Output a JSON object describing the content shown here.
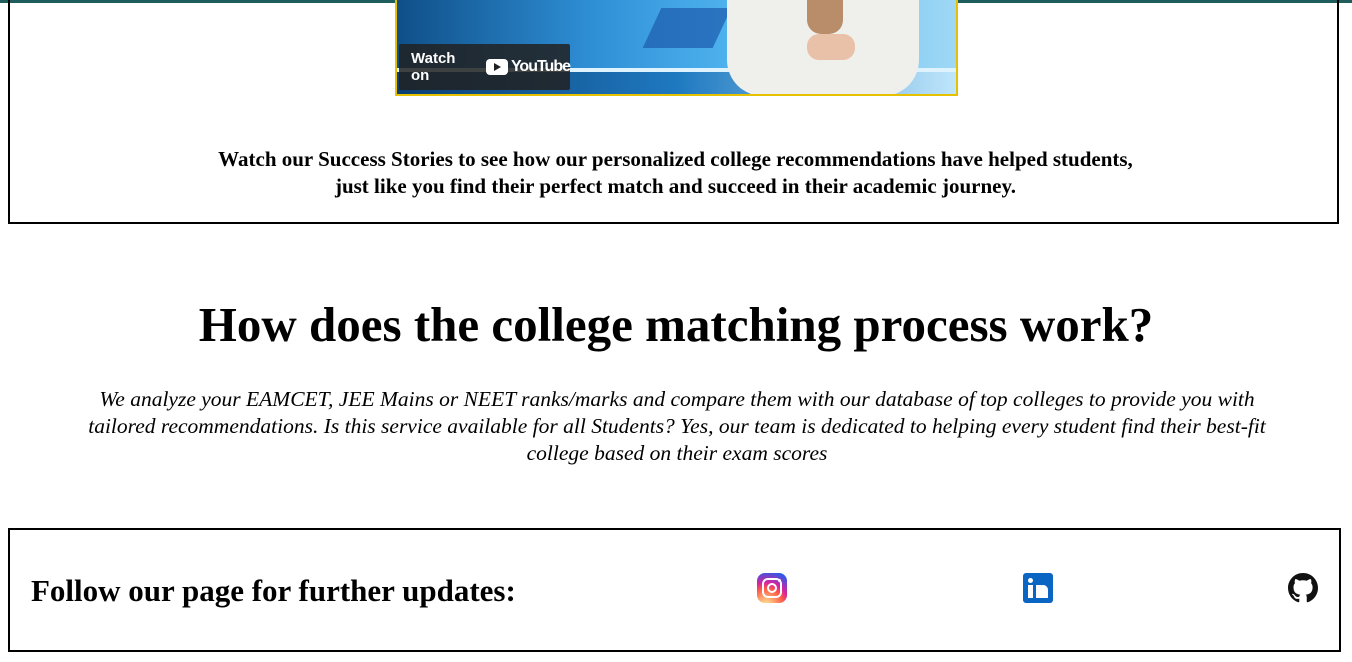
{
  "video": {
    "watch_on_label": "Watch on",
    "youtube_label": "YouTube",
    "caption_line1": "Watch our Success Stories to see how our personalized college recommendations have helped students,",
    "caption_line2": "just like you find their perfect match and succeed in their academic journey."
  },
  "process": {
    "heading": "How does the college matching process work?",
    "line1": "We analyze your EAMCET, JEE Mains or NEET ranks/marks and compare them with our database of top colleges to provide you with",
    "line2": "tailored recommendations. Is this service available for all Students? Yes, our team is dedicated to helping every student find their best-fit",
    "line3": "college based on their exam scores"
  },
  "follow": {
    "title": "Follow our page for further updates:",
    "icons": [
      "instagram-icon",
      "linkedin-icon",
      "github-icon"
    ]
  },
  "colors": {
    "top_bar": "#1f5c5c",
    "video_border": "#e5c100",
    "linkedin": "#0a66c2"
  }
}
